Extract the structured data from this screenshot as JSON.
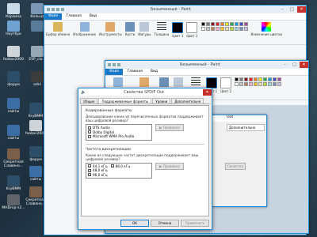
{
  "desktop": {
    "icons": [
      {
        "label": "Корзина",
        "color": "#c9d9e6"
      },
      {
        "label": "Кольца",
        "color": "#7d98b5"
      },
      {
        "label": "Ноутбук",
        "color": "#6fa2d1"
      },
      {
        "label": "",
        "color": "#5a7a9a"
      },
      {
        "label": "foobar2000",
        "color": "#cfd4d8"
      },
      {
        "label": "ESP_clo...",
        "color": "#95a8b4"
      },
      {
        "label": "форум",
        "color": "#2c4e68"
      },
      {
        "label": "odnl",
        "color": "#3c3c3c"
      },
      {
        "label": "сайты",
        "color": "#3a6ea5"
      },
      {
        "label": "сайты",
        "color": "#3a6ea5"
      },
      {
        "label": "Секретная Славяно...",
        "color": "#7a5f4a"
      },
      {
        "label": "KryBMM",
        "color": "#2c4e68"
      },
      {
        "label": "MHDrop-s2...",
        "color": "#60646a"
      },
      {
        "label": "KryBMM",
        "color": "#2c4e68"
      },
      {
        "label": "foobar2000",
        "color": "#cfd4d8"
      },
      {
        "label": "форум",
        "color": "#2c4e68"
      },
      {
        "label": "сайты",
        "color": "#3a6ea5"
      },
      {
        "label": "Секретная Славяно...",
        "color": "#7a5f4a"
      }
    ]
  },
  "paint1": {
    "title": "Безымянный - Paint",
    "tabs": [
      "Файл",
      "Главная",
      "Вид"
    ],
    "ribbon": [
      "Буфер обмена",
      "Изображение",
      "Инструменты",
      "Кисти",
      "Фигуры",
      "Толщина",
      "Цвет 1",
      "Цвет 2",
      "Изменение цветов"
    ]
  },
  "paint2": {
    "title": "Безымянный - Paint",
    "tabs": [
      "Файл",
      "Главная",
      "Вид"
    ],
    "ribbon": [
      "Изображение",
      "Инструменты",
      "Кисти",
      "Фигуры",
      "Толщина",
      "Цвет 1",
      "Цвет 2"
    ]
  },
  "back_dialog": {
    "title": "Out",
    "tab": "Дополнительно",
    "button": "Свойства"
  },
  "dialog": {
    "title": "Свойства SPDIF Out",
    "tabs": [
      "Общие",
      "Поддерживаемые форматы",
      "Уровни",
      "Дополнительно"
    ],
    "encoded": {
      "section": "Кодированные форматы",
      "desc": "Декодирование каких из перечисленных форматов поддерживает ваш цифровой ресивер?",
      "items": [
        {
          "label": "DTS Audio",
          "checked": true
        },
        {
          "label": "Dolby Digital",
          "checked": true
        },
        {
          "label": "Microsoft WMA Pro Audio",
          "checked": false
        }
      ],
      "button": "Проверка"
    },
    "rates": {
      "section": "Частота дискретизации",
      "desc": "Какие из следующих частот дискретизации поддерживает ваш цифровой ресивер?",
      "col1": [
        {
          "label": "44,1 кГц",
          "checked": true
        },
        {
          "label": "48,0 кГц",
          "checked": true
        },
        {
          "label": "96,0 кГц",
          "checked": true
        }
      ],
      "col2": [
        {
          "label": "88,0 кГц",
          "checked": true
        }
      ],
      "button": "Проверка"
    },
    "ok": "OK",
    "cancel": "Отмена",
    "apply": "Применить"
  },
  "colors": {
    "accent": "#1979ca",
    "close": "#c7302a",
    "palette": [
      "#000000",
      "#7f7f7f",
      "#880015",
      "#ed1c24",
      "#ff7f27",
      "#fff200",
      "#22b14c",
      "#00a2e8",
      "#3f48cc",
      "#a349a4",
      "#ffffff",
      "#c3c3c3",
      "#b97a57",
      "#ffaec9",
      "#ffc90e",
      "#efe4b0",
      "#b5e61d",
      "#99d9ea",
      "#7092be",
      "#c8bfe7"
    ]
  }
}
